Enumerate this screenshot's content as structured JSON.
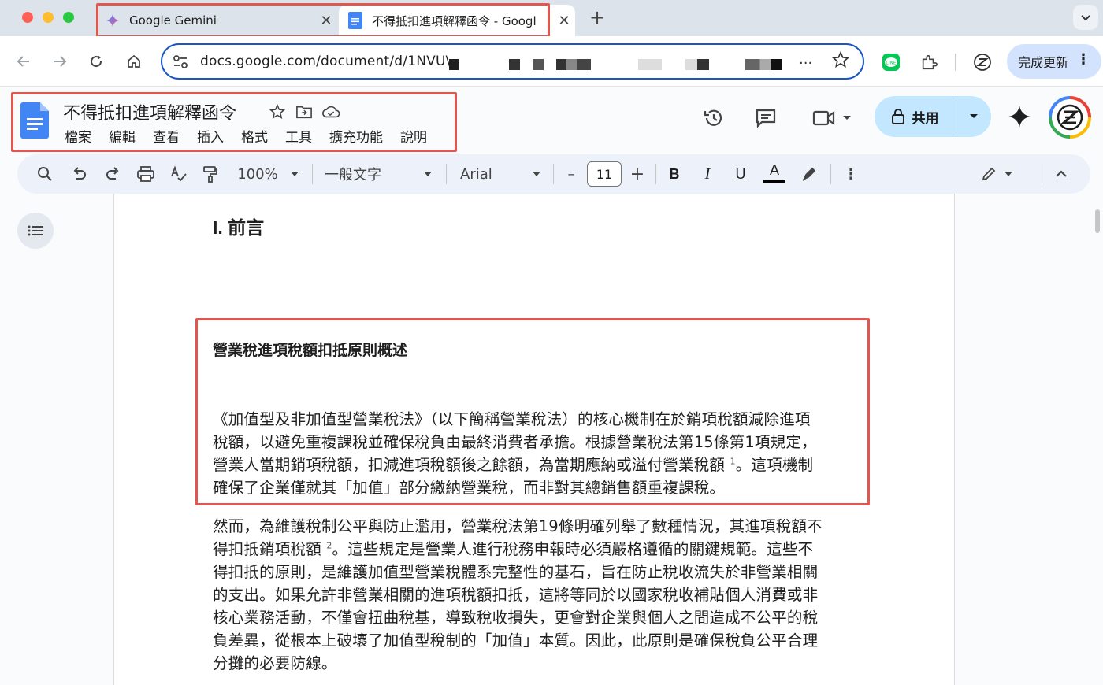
{
  "browser": {
    "tabs": [
      {
        "title": "Google Gemini",
        "close": "✕"
      },
      {
        "title": "不得抵扣進項解釋函令 - Googl",
        "close": "✕"
      }
    ],
    "new_tab": "+",
    "url": "docs.google.com/document/d/1NVU\\",
    "url_ellipsis": "...",
    "update_label": "完成更新",
    "update_menu": "⋮"
  },
  "docs": {
    "title": "不得抵扣進項解釋函令",
    "menu": [
      "檔案",
      "編輯",
      "查看",
      "插入",
      "格式",
      "工具",
      "擴充功能",
      "說明"
    ],
    "share_label": "共用"
  },
  "toolbar": {
    "zoom": "100%",
    "style": "一般文字",
    "font": "Arial",
    "font_size": "11",
    "minus": "–",
    "plus": "+",
    "bold": "B",
    "italic": "I",
    "underline": "U",
    "text_color": "A",
    "more": "⋮"
  },
  "document": {
    "heading": "I. 前言",
    "subheading": "營業稅進項稅額扣抵原則概述",
    "para1_lines": [
      "《加值型及非加值型營業稅法》（以下簡稱營業稅法）的核心機制在於銷項稅額減除進項",
      "稅額，以避免重複課稅並確保稅負由最終消費者承擔。根據營業稅法第15條第1項規定，",
      "營業人當期銷項稅額，扣減進項稅額後之餘額，為當期應納或溢付營業稅額",
      "確保了企業僅就其「加值」部分繳納營業稅，而非對其總銷售額重複課稅。"
    ],
    "para1_footnote": "1",
    "para1_line3_tail": "。這項機制",
    "para2_line1": "然而，為維護稅制公平與防止濫用，營業稅法第19條明確列舉了數種情況，其進項稅額不",
    "para2_line2_head": "得扣抵銷項稅額",
    "para2_footnote": "2",
    "para2_line2_tail": "。這些規定是營業人進行稅務申報時必須嚴格遵循的關鍵規範。這些不",
    "para2_lines": [
      "得扣抵的原則，是維護加值型營業稅體系完整性的基石，旨在防止稅收流失於非營業相關",
      "的支出。如果允許非營業相關的進項稅額扣抵，這將等同於以國家稅收補貼個人消費或非",
      "核心業務活動，不僅會扭曲稅基，導致稅收損失，更會對企業與個人之間造成不公平的稅",
      "負差異，從根本上破壞了加值型稅制的「加值」本質。因此，此原則是確保稅負公平合理",
      "分攤的必要防線。"
    ]
  },
  "colors": {
    "highlight_border": "#e0574f",
    "docs_blue": "#4285f4",
    "share_bg": "#c2e7ff",
    "omnibox_border": "#1a56c4"
  }
}
